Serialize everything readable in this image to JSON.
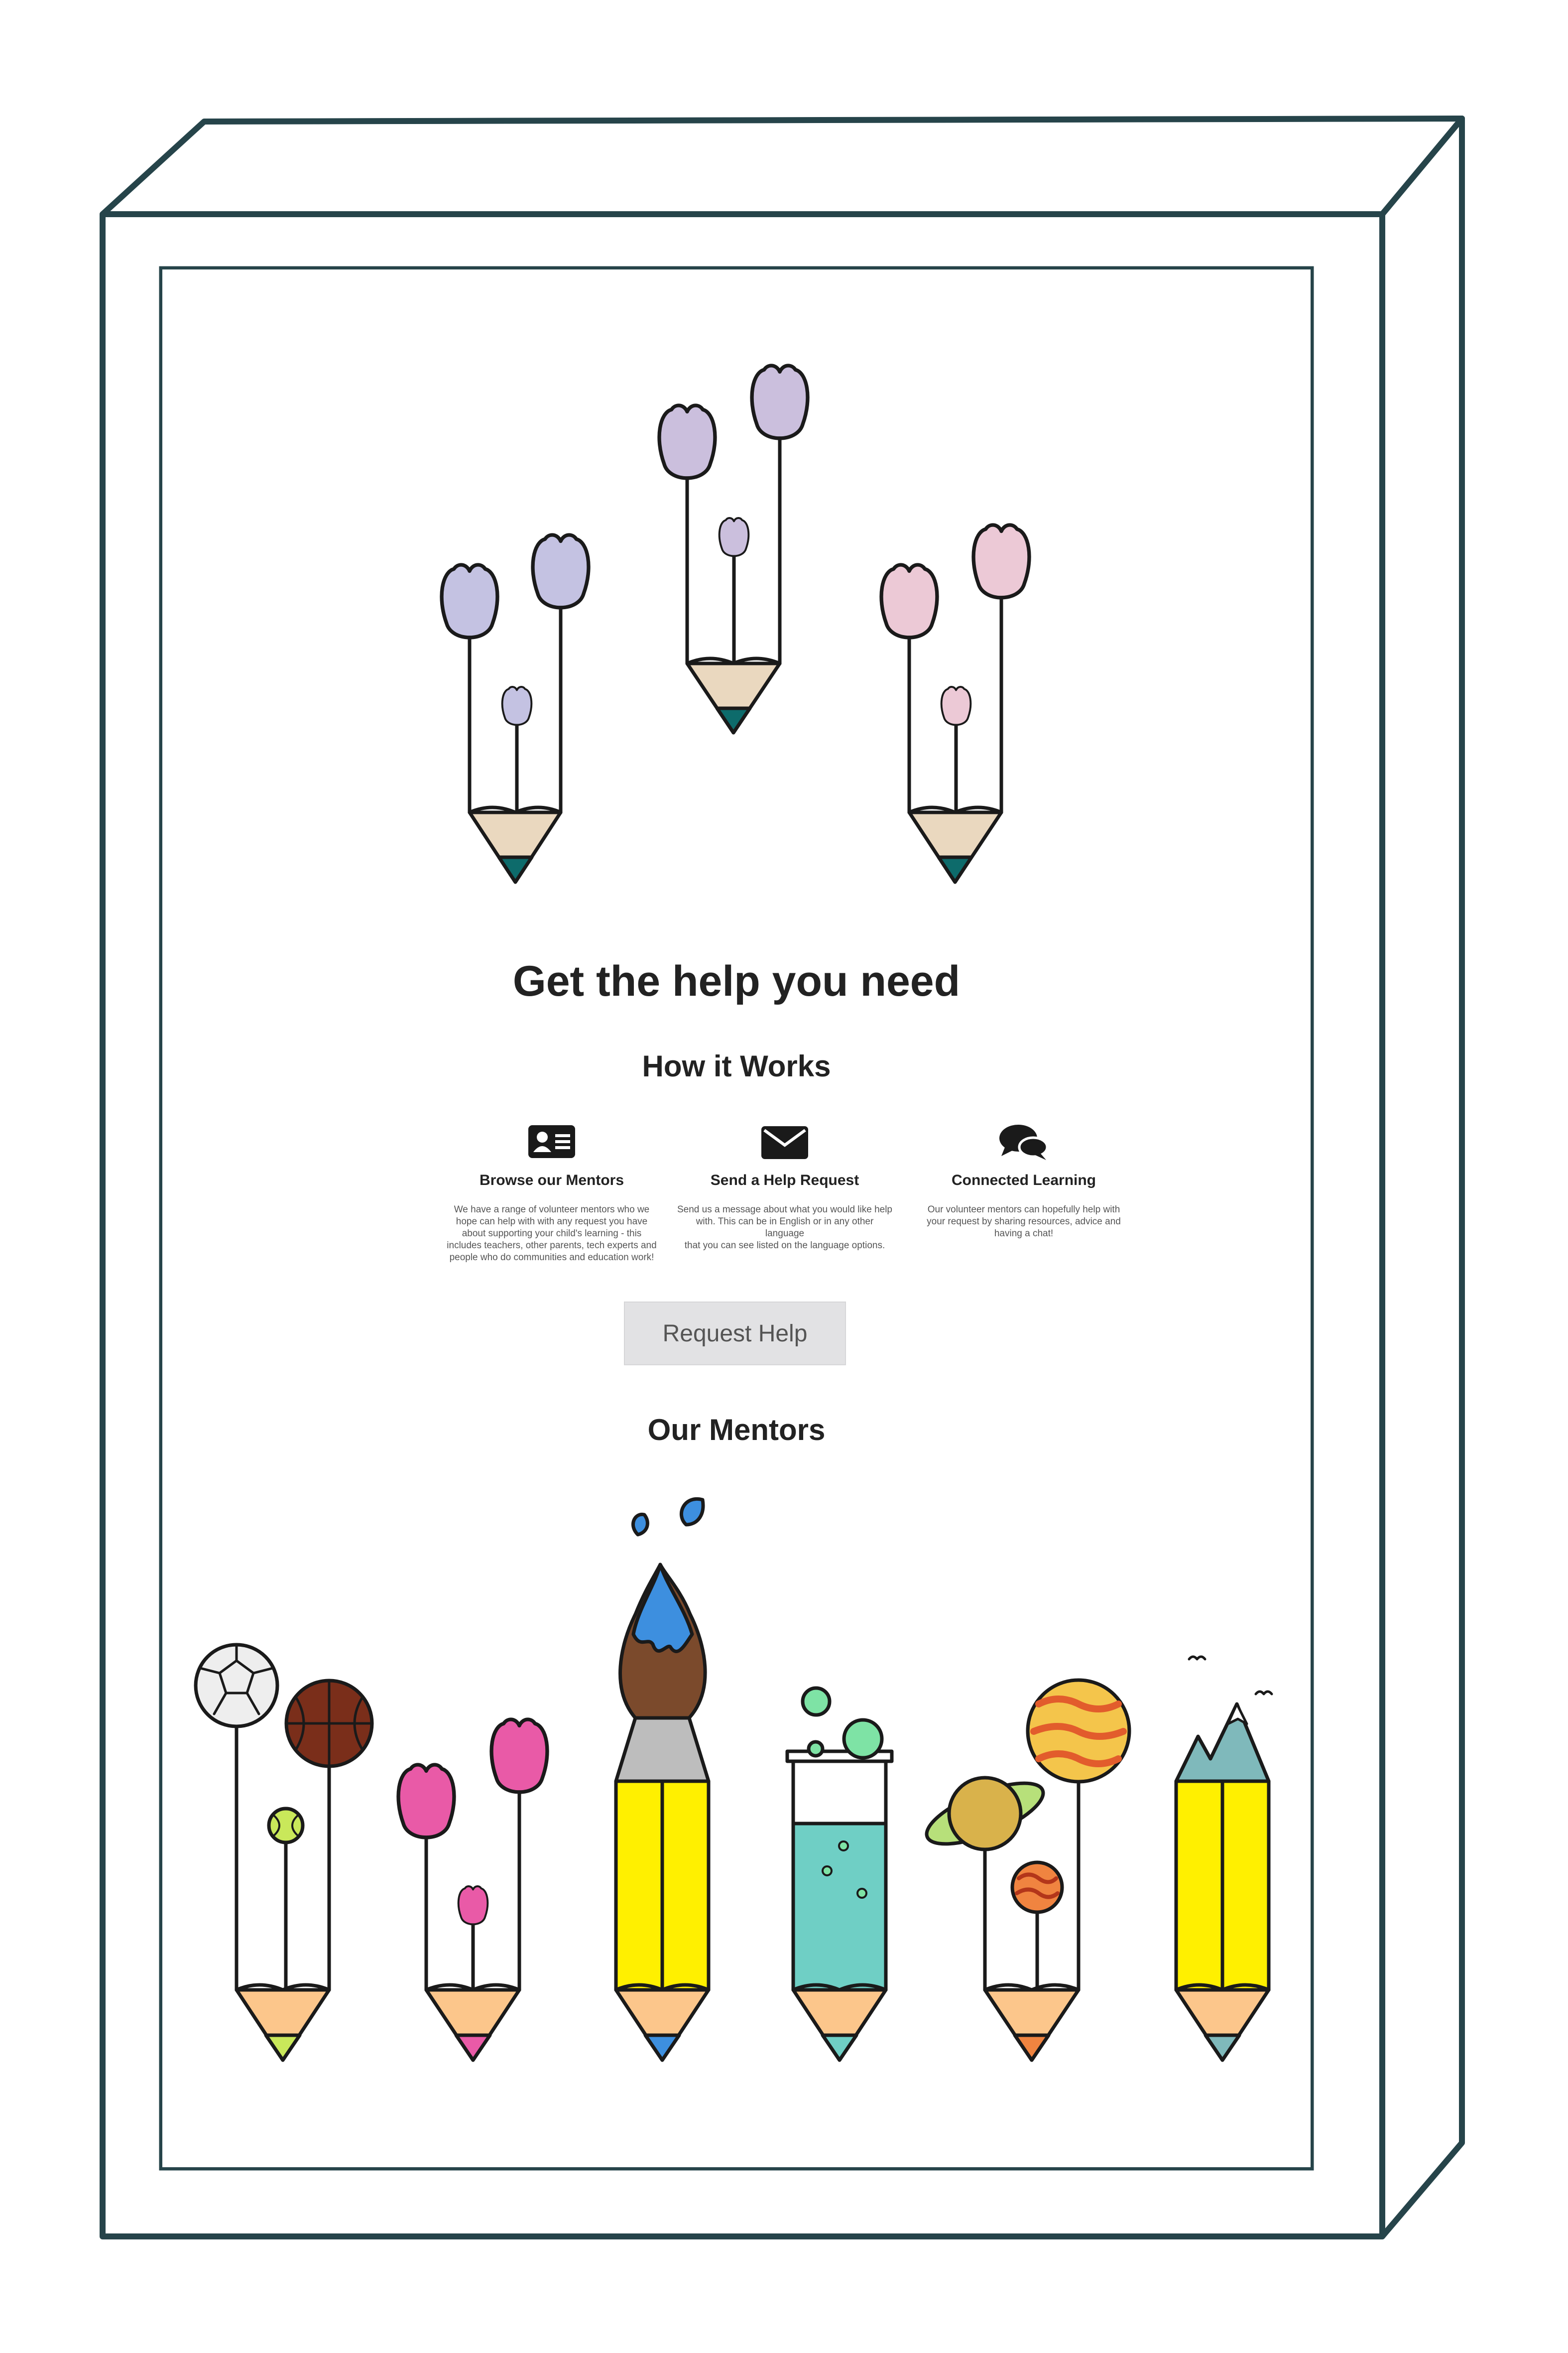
{
  "page": {
    "title": "Get the help you need",
    "how_it_works_heading": "How it Works",
    "request_button_label": "Request Help",
    "mentors_heading": "Our Mentors"
  },
  "steps": [
    {
      "icon": "id-card-icon",
      "title": "Browse our Mentors",
      "lines": [
        "We have a range of volunteer mentors who we",
        "hope can help with with any request you have",
        "about supporting your child's learning - this",
        "includes teachers, other parents, tech experts and",
        "people who do communities and education work!"
      ]
    },
    {
      "icon": "envelope-icon",
      "title": "Send a Help Request",
      "lines": [
        "Send us a message about what you would like help",
        "with. This can be in English or in any other language",
        "that you can see listed on the language options."
      ]
    },
    {
      "icon": "chat-bubbles-icon",
      "title": "Connected Learning",
      "lines": [
        "Our volunteer mentors can hopefully help with",
        "your request by sharing resources, advice and",
        "having a chat!"
      ]
    }
  ],
  "colors": {
    "frame": "#26444a",
    "lavender_tulip": "#c4c2e2",
    "lilac_tulip": "#cbbfdd",
    "pink_tulip": "#ecc9d6",
    "pencil_wood": "#ead8bf",
    "pencil_tip_teal": "#0d6b6b",
    "wood_peach": "#fcc68b",
    "yellow": "#fff000",
    "magenta": "#e95aa7",
    "aqua": "#6fcfc5",
    "brush_blue": "#3d8fdf",
    "brush_brown": "#7b4a2c",
    "planet_orange": "#f08440",
    "heading_text": "#222222",
    "button_bg": "#e2e2e4"
  }
}
